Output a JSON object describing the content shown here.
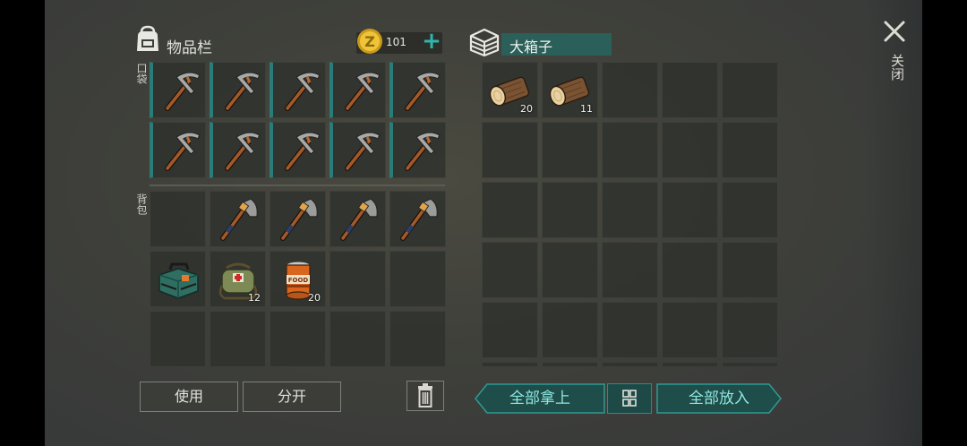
{
  "inventory": {
    "title": "物品栏",
    "coins": "101",
    "pocket_label": "口袋",
    "backpack_label": "背包",
    "pocket_slots": [
      {
        "item": "pickaxe-icon",
        "equipped": true
      },
      {
        "item": "pickaxe-icon",
        "equipped": true
      },
      {
        "item": "pickaxe-icon",
        "equipped": true
      },
      {
        "item": "pickaxe-icon",
        "equipped": true
      },
      {
        "item": "pickaxe-icon",
        "equipped": true
      },
      {
        "item": "pickaxe-icon",
        "equipped": true
      },
      {
        "item": "pickaxe-icon",
        "equipped": true
      },
      {
        "item": "pickaxe-icon",
        "equipped": true
      },
      {
        "item": "pickaxe-icon",
        "equipped": true
      },
      {
        "item": "pickaxe-icon",
        "equipped": true
      }
    ],
    "backpack_slots": [
      {
        "item": ""
      },
      {
        "item": "axe-icon"
      },
      {
        "item": "axe-icon"
      },
      {
        "item": "axe-icon"
      },
      {
        "item": "axe-icon"
      },
      {
        "item": "toolbox-icon"
      },
      {
        "item": "medkit-bag-icon",
        "count": "12"
      },
      {
        "item": "food-can-icon",
        "count": "20"
      },
      {
        "item": ""
      },
      {
        "item": ""
      },
      {
        "item": ""
      },
      {
        "item": ""
      },
      {
        "item": ""
      },
      {
        "item": ""
      },
      {
        "item": ""
      }
    ]
  },
  "chest": {
    "title": "大箱子",
    "slots": [
      {
        "item": "wood-log-icon",
        "count": "20"
      },
      {
        "item": "wood-log-icon",
        "count": "11"
      },
      {
        "item": ""
      },
      {
        "item": ""
      },
      {
        "item": ""
      },
      {
        "item": ""
      },
      {
        "item": ""
      },
      {
        "item": ""
      },
      {
        "item": ""
      },
      {
        "item": ""
      },
      {
        "item": ""
      },
      {
        "item": ""
      },
      {
        "item": ""
      },
      {
        "item": ""
      },
      {
        "item": ""
      },
      {
        "item": ""
      },
      {
        "item": ""
      },
      {
        "item": ""
      },
      {
        "item": ""
      },
      {
        "item": ""
      },
      {
        "item": ""
      },
      {
        "item": ""
      },
      {
        "item": ""
      },
      {
        "item": ""
      },
      {
        "item": ""
      },
      {
        "item": ""
      },
      {
        "item": ""
      },
      {
        "item": ""
      },
      {
        "item": ""
      },
      {
        "item": ""
      }
    ]
  },
  "buttons": {
    "use": "使用",
    "split": "分开",
    "take_all": "全部拿上",
    "put_all": "全部放入",
    "close": "关闭"
  },
  "colors": {
    "accent": "#2fb5ad",
    "equipped_bar": "#2a7c78",
    "chest_title_bg": "#2b5f5a"
  }
}
